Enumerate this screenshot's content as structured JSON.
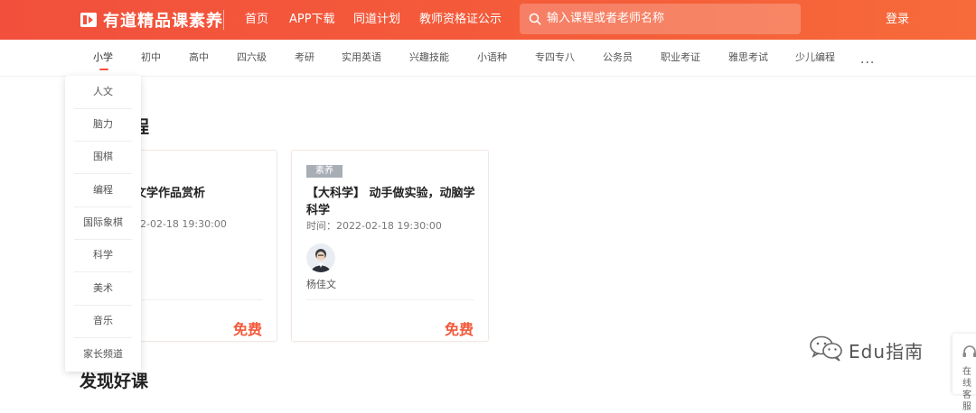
{
  "header": {
    "logo_text": "有道精品课素养",
    "nav": [
      "首页",
      "APP下载",
      "同道计划",
      "教师资格证公示"
    ],
    "search_placeholder": "输入课程或者老师名称",
    "login_label": "登录"
  },
  "tabs": {
    "items": [
      "小学",
      "初中",
      "高中",
      "四六级",
      "考研",
      "实用英语",
      "兴趣技能",
      "小语种",
      "专四专八",
      "公务员",
      "职业考证",
      "雅思考试",
      "少儿编程"
    ],
    "active": "小学",
    "more_label": "..."
  },
  "dropdown": {
    "items": [
      "人文",
      "脑力",
      "围棋",
      "编程",
      "国际象棋",
      "科学",
      "美术",
      "音乐",
      "家长频道"
    ]
  },
  "sections": {
    "featured_title_partial": "程课程",
    "featured_title_visible": "程",
    "discover_title": "发现好课"
  },
  "cards": [
    {
      "tag": "",
      "title": "文学作品赏析",
      "time": "2-02-18 19:30:00",
      "teacher": "",
      "price": "免费"
    },
    {
      "tag": "素养",
      "title": "【大科学】 动手做实验，动脑学科学",
      "time": "时间：2022-02-18 19:30:00",
      "teacher": "杨佳文",
      "price": "免费"
    }
  ],
  "watermark": {
    "text": "Edu指南"
  },
  "side_widget": {
    "text": "在线客服"
  },
  "colors": {
    "brand": "#f3523f",
    "price": "#f25a3c",
    "tag_bg": "#a8aeb6"
  },
  "icons": [
    "logo-play-icon",
    "search-icon",
    "more-dots-icon",
    "wechat-icon",
    "headset-icon"
  ]
}
